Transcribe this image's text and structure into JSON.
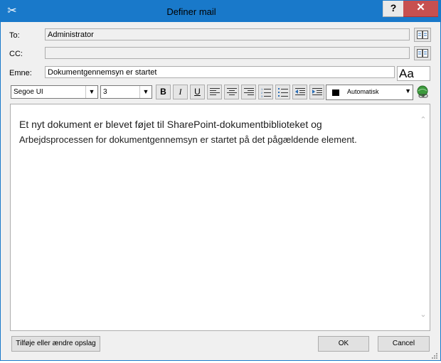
{
  "window": {
    "title": "Definer mail",
    "help_label": "?",
    "close_label": "✕"
  },
  "form": {
    "to": {
      "label": "To:",
      "value": "Administrator"
    },
    "cc": {
      "label": "CC:",
      "value": ""
    },
    "subject": {
      "label": "Emne:",
      "value": "Dokumentgennemsyn er startet"
    },
    "aa_label": "Aa"
  },
  "toolbar": {
    "font": "Segoe UI",
    "size": "3",
    "bold": "B",
    "italic": "I",
    "underline": "U",
    "color_label": "Automatisk",
    "color_value": "#000000"
  },
  "body": {
    "line1": "Et nyt dokument er blevet føjet til SharePoint-dokumentbiblioteket og",
    "line2": "Arbejdsprocessen for dokumentgennemsyn er startet på det pågældende element."
  },
  "footer": {
    "lookup_label": "Tilføje eller ændre opslag",
    "ok_label": "OK",
    "cancel_label": "Cancel"
  },
  "colors": {
    "titlebar": "#1979ca",
    "close": "#c75050"
  }
}
